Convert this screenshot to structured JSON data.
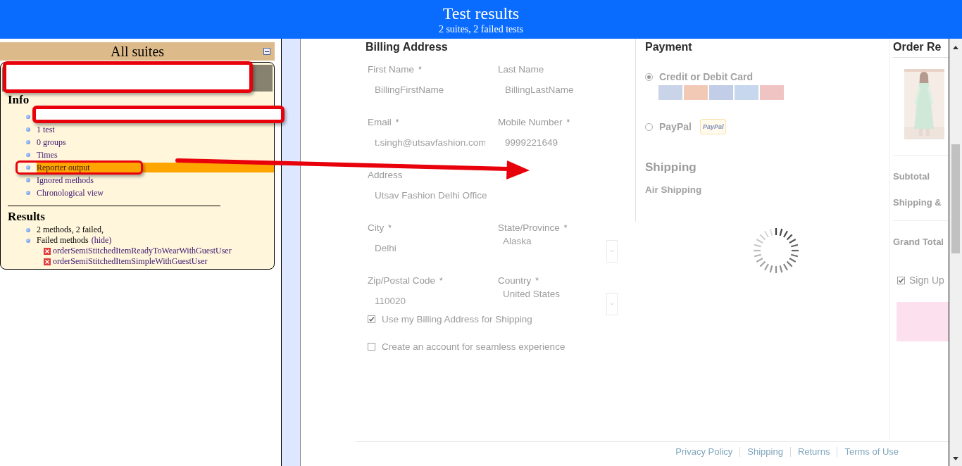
{
  "header": {
    "title": "Test results",
    "subtitle": "2 suites, 2 failed tests"
  },
  "suites": {
    "title": "All suites",
    "info_title": "Info",
    "info_items": [
      {
        "label": "1 test",
        "selected": false
      },
      {
        "label": "0 groups",
        "selected": false
      },
      {
        "label": "Times",
        "selected": false
      },
      {
        "label": "Reporter output",
        "selected": true
      },
      {
        "label": "Ignored methods",
        "selected": false
      },
      {
        "label": "Chronological view",
        "selected": false
      }
    ],
    "results_title": "Results",
    "results_items": [
      {
        "kind": "text",
        "label": "2 methods, 2 failed,"
      },
      {
        "kind": "toggle",
        "label": "Failed methods",
        "link": "(hide)"
      }
    ],
    "failed_methods": [
      "orderSemiStitchedItemReadyToWearWithGuestUser",
      "orderSemiStitchedItemSimpleWithGuestUser"
    ]
  },
  "checkout": {
    "billing": {
      "title": "Billing Address",
      "fields": [
        {
          "kind": "text",
          "label": "First Name",
          "mark": "*",
          "value": "BillingFirstName"
        },
        {
          "kind": "text",
          "label": "Last Name",
          "value": "BillingLastName"
        },
        {
          "kind": "text",
          "label": "Email",
          "mark": "*",
          "value": "t.singh@utsavfashion.com"
        },
        {
          "kind": "text",
          "label": "Mobile Number",
          "mark": "*",
          "value": "9999221649"
        },
        {
          "kind": "wide",
          "label": "Address",
          "value": "Utsav Fashion Delhi Office"
        },
        {
          "kind": "text",
          "label": "City",
          "mark": "*",
          "value": "Delhi"
        },
        {
          "kind": "select",
          "label": "State/Province",
          "mark": "*",
          "value": "Alaska"
        },
        {
          "kind": "text",
          "label": "Zip/Postal Code",
          "mark": "*",
          "value": "110020"
        },
        {
          "kind": "select",
          "label": "Country",
          "mark": "*",
          "value": "United States"
        }
      ],
      "checkboxes": [
        {
          "label": "Use my Billing Address for Shipping",
          "checked": true
        },
        {
          "label": "Create an account for seamless experience",
          "checked": false
        }
      ]
    },
    "payment": {
      "title": "Payment",
      "options": [
        {
          "kind": "cards",
          "label": "Credit or Debit Card",
          "selected": true
        },
        {
          "kind": "paypal",
          "label": "PayPal",
          "badge": "PayPal",
          "selected": false
        }
      ],
      "shipping_title": "Shipping",
      "shipping_method": "Air Shipping"
    },
    "order": {
      "title": "Order Re",
      "summary": [
        "Subtotal",
        "Shipping &",
        "Grand Total"
      ],
      "signup": {
        "label": "Sign Up",
        "checked": true
      }
    },
    "footer_links": [
      "Privacy Policy",
      "Shipping",
      "Returns",
      "Terms of Use"
    ]
  }
}
